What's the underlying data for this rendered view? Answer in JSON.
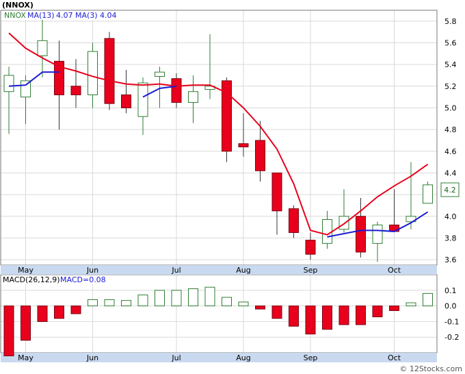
{
  "title": "(NNOX)",
  "watermark": "© 12Stocks.com",
  "price_legend": {
    "symbol": "NNOX",
    "ma13_label": "MA(13)",
    "ma13_value": "4.07",
    "ma3_label": "MA(3)",
    "ma3_value": "4.04"
  },
  "macd_legend": {
    "label": "MACD(26,12,9)",
    "macd_label": "MACD=0.08"
  },
  "last_price_label": "4.2",
  "colors": {
    "up": "#ffffff",
    "up_border": "#2e7d32",
    "down": "#e8001c",
    "ma13": "#e8001c",
    "ma3": "#1a1ad6",
    "axis_strip": "#c9d9ef",
    "grid": "#d9d9d9",
    "badge_border": "#2e7d32",
    "legend_symbol": "#2e7d32"
  },
  "chart_data": [
    {
      "type": "candlestick",
      "title": "NNOX",
      "x_labels": [
        "May",
        "Jun",
        "Jul",
        "Aug",
        "Sep",
        "Oct"
      ],
      "x_label_weeks": [
        1,
        5,
        10,
        14,
        18,
        23
      ],
      "ylim": [
        3.55,
        5.9
      ],
      "y_ticks": [
        3.6,
        3.8,
        4.0,
        4.2,
        4.4,
        4.6,
        4.8,
        5.0,
        5.2,
        5.4,
        5.6,
        5.8
      ],
      "y_tick_labels": [
        "3.6",
        "3.8",
        "4.0",
        "",
        "4.4",
        "4.6",
        "4.8",
        "5.0",
        "5.2",
        "5.4",
        "5.6",
        "5.8"
      ],
      "candles": [
        {
          "o": 5.15,
          "h": 5.38,
          "l": 4.76,
          "c": 5.3
        },
        {
          "o": 5.1,
          "h": 5.3,
          "l": 4.85,
          "c": 5.25
        },
        {
          "o": 5.48,
          "h": 5.85,
          "l": 5.28,
          "c": 5.62
        },
        {
          "o": 5.43,
          "h": 5.62,
          "l": 4.8,
          "c": 5.12
        },
        {
          "o": 5.2,
          "h": 5.45,
          "l": 5.0,
          "c": 5.12
        },
        {
          "o": 5.12,
          "h": 5.6,
          "l": 5.0,
          "c": 5.52
        },
        {
          "o": 5.64,
          "h": 5.7,
          "l": 4.98,
          "c": 5.04
        },
        {
          "o": 5.12,
          "h": 5.35,
          "l": 4.95,
          "c": 5.0
        },
        {
          "o": 4.92,
          "h": 5.28,
          "l": 4.75,
          "c": 5.23
        },
        {
          "o": 5.29,
          "h": 5.38,
          "l": 5.0,
          "c": 5.33
        },
        {
          "o": 5.27,
          "h": 5.32,
          "l": 5.0,
          "c": 5.05
        },
        {
          "o": 5.05,
          "h": 5.3,
          "l": 4.86,
          "c": 5.15
        },
        {
          "o": 5.17,
          "h": 5.68,
          "l": 5.08,
          "c": 5.2
        },
        {
          "o": 5.25,
          "h": 5.28,
          "l": 4.5,
          "c": 4.6
        },
        {
          "o": 4.67,
          "h": 4.95,
          "l": 4.55,
          "c": 4.64
        },
        {
          "o": 4.7,
          "h": 4.88,
          "l": 4.32,
          "c": 4.42
        },
        {
          "o": 4.4,
          "h": 4.4,
          "l": 3.83,
          "c": 4.05
        },
        {
          "o": 4.07,
          "h": 4.1,
          "l": 3.8,
          "c": 3.85
        },
        {
          "o": 3.78,
          "h": 3.85,
          "l": 3.6,
          "c": 3.65
        },
        {
          "o": 3.75,
          "h": 4.05,
          "l": 3.7,
          "c": 3.97
        },
        {
          "o": 3.88,
          "h": 4.25,
          "l": 3.85,
          "c": 4.0
        },
        {
          "o": 4.0,
          "h": 4.17,
          "l": 3.62,
          "c": 3.67
        },
        {
          "o": 3.75,
          "h": 3.95,
          "l": 3.58,
          "c": 3.92
        },
        {
          "o": 3.92,
          "h": 4.25,
          "l": 3.92,
          "c": 3.86
        },
        {
          "o": 3.95,
          "h": 4.5,
          "l": 3.88,
          "c": 4.0
        },
        {
          "o": 4.12,
          "h": 4.32,
          "l": 4.12,
          "c": 4.29
        }
      ],
      "series": [
        {
          "name": "MA(13)",
          "values": [
            5.69,
            5.55,
            5.46,
            5.38,
            5.34,
            5.29,
            5.25,
            5.22,
            5.21,
            5.22,
            5.2,
            5.21,
            5.21,
            5.14,
            5.0,
            4.83,
            4.62,
            4.3,
            3.87,
            3.83,
            3.93,
            4.05,
            4.18,
            4.28,
            4.37,
            4.48
          ]
        },
        {
          "name": "MA(3)",
          "start_index": 0,
          "values": [
            5.2,
            5.21,
            5.33,
            5.33,
            null,
            null,
            null,
            null,
            5.1,
            5.18,
            5.2,
            null,
            null,
            null,
            null,
            null,
            null,
            null,
            null,
            3.81,
            3.84,
            3.87,
            3.87,
            3.86,
            3.94,
            4.04
          ]
        }
      ]
    },
    {
      "type": "bar",
      "title": "MACD(26,12,9)",
      "ylim": [
        -0.3,
        0.2
      ],
      "y_ticks": [
        -0.2,
        -0.1,
        0.0,
        0.1
      ],
      "y_tick_labels": [
        "-0.2",
        "-0.1",
        "0.0",
        "0.1"
      ],
      "values": [
        -0.32,
        -0.22,
        -0.1,
        -0.08,
        -0.05,
        0.04,
        0.04,
        0.035,
        0.07,
        0.1,
        0.1,
        0.11,
        0.12,
        0.055,
        0.025,
        -0.02,
        -0.08,
        -0.13,
        -0.18,
        -0.15,
        -0.12,
        -0.12,
        -0.07,
        -0.03,
        0.02,
        0.08
      ]
    }
  ]
}
